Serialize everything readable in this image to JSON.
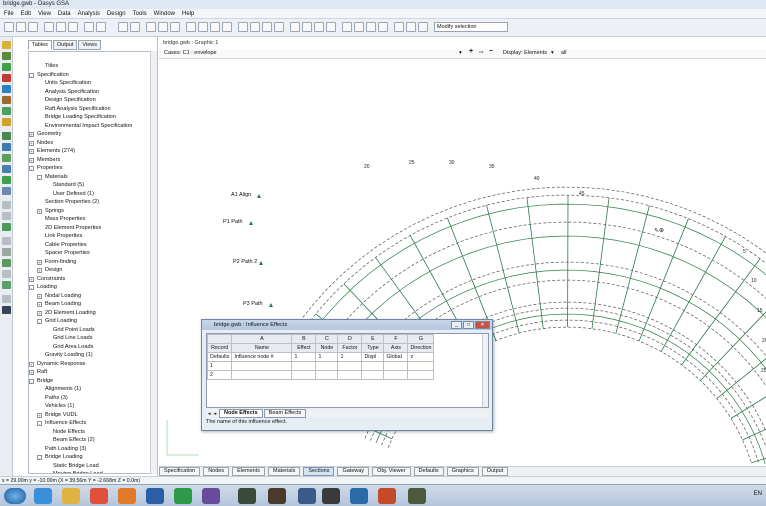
{
  "window": {
    "title": "bridge.gwb - Oasys GSA"
  },
  "menu": [
    "File",
    "Edit",
    "View",
    "Data",
    "Analysis",
    "Design",
    "Tools",
    "Window",
    "Help"
  ],
  "toolbar": {
    "mode_select": "Modify selection"
  },
  "left_panel": {
    "tabs": [
      "Tables",
      "Output",
      "Views"
    ],
    "tree": [
      {
        "label": "Titles",
        "level": 1,
        "exp": ""
      },
      {
        "label": "Specification",
        "level": 0,
        "exp": "-"
      },
      {
        "label": "Units Specification",
        "level": 1,
        "exp": ""
      },
      {
        "label": "Analysis Specification",
        "level": 1,
        "exp": ""
      },
      {
        "label": "Design Specification",
        "level": 1,
        "exp": ""
      },
      {
        "label": "Raft Analysis Specification",
        "level": 1,
        "exp": ""
      },
      {
        "label": "Bridge Loading Specification",
        "level": 1,
        "exp": ""
      },
      {
        "label": "Environmental Impact Specification",
        "level": 1,
        "exp": ""
      },
      {
        "label": "Geometry",
        "level": 0,
        "exp": "+"
      },
      {
        "label": "Nodes",
        "level": 0,
        "exp": "+"
      },
      {
        "label": "Elements (274)",
        "level": 0,
        "exp": "+"
      },
      {
        "label": "Members",
        "level": 0,
        "exp": "+"
      },
      {
        "label": "Properties",
        "level": 0,
        "exp": "-"
      },
      {
        "label": "Materials",
        "level": 1,
        "exp": "-"
      },
      {
        "label": "Standard (5)",
        "level": 2,
        "exp": ""
      },
      {
        "label": "User Defined (1)",
        "level": 2,
        "exp": ""
      },
      {
        "label": "Section Properties (2)",
        "level": 1,
        "exp": ""
      },
      {
        "label": "Springs",
        "level": 1,
        "exp": "+"
      },
      {
        "label": "Mass Properties",
        "level": 1,
        "exp": ""
      },
      {
        "label": "2D Element Properties",
        "level": 1,
        "exp": ""
      },
      {
        "label": "Link Properties",
        "level": 1,
        "exp": ""
      },
      {
        "label": "Cable Properties",
        "level": 1,
        "exp": ""
      },
      {
        "label": "Spacer Properties",
        "level": 1,
        "exp": ""
      },
      {
        "label": "Form-finding",
        "level": 1,
        "exp": "+"
      },
      {
        "label": "Design",
        "level": 1,
        "exp": "+"
      },
      {
        "label": "Constraints",
        "level": 0,
        "exp": "+"
      },
      {
        "label": "Loading",
        "level": 0,
        "exp": "-"
      },
      {
        "label": "Nodal Loading",
        "level": 1,
        "exp": "+"
      },
      {
        "label": "Beam Loading",
        "level": 1,
        "exp": "+"
      },
      {
        "label": "2D Element Loading",
        "level": 1,
        "exp": "+"
      },
      {
        "label": "Grid Loading",
        "level": 1,
        "exp": "-"
      },
      {
        "label": "Grid Point Loads",
        "level": 2,
        "exp": ""
      },
      {
        "label": "Grid Line Loads",
        "level": 2,
        "exp": ""
      },
      {
        "label": "Grid Area Loads",
        "level": 2,
        "exp": ""
      },
      {
        "label": "Gravity Loading (1)",
        "level": 1,
        "exp": ""
      },
      {
        "label": "Dynamic Response",
        "level": 0,
        "exp": "+"
      },
      {
        "label": "Raft",
        "level": 0,
        "exp": "+"
      },
      {
        "label": "Bridge",
        "level": 0,
        "exp": "-"
      },
      {
        "label": "Alignments (1)",
        "level": 1,
        "exp": ""
      },
      {
        "label": "Paths (3)",
        "level": 1,
        "exp": ""
      },
      {
        "label": "Vehicles (1)",
        "level": 1,
        "exp": ""
      },
      {
        "label": "Bridge VUDL",
        "level": 1,
        "exp": "+"
      },
      {
        "label": "Influence Effects",
        "level": 1,
        "exp": "-"
      },
      {
        "label": "Node Effects",
        "level": 2,
        "exp": ""
      },
      {
        "label": "Beam Effects (2)",
        "level": 2,
        "exp": ""
      },
      {
        "label": "Path Loading (3)",
        "level": 1,
        "exp": ""
      },
      {
        "label": "Bridge Loading",
        "level": 1,
        "exp": "-"
      },
      {
        "label": "Static Bridge Load",
        "level": 2,
        "exp": ""
      },
      {
        "label": "Moving Bridge Load",
        "level": 2,
        "exp": ""
      }
    ]
  },
  "graphic": {
    "tab": "bridge.gwb : Graphic 1",
    "cases": "Cases: C1 : envelope",
    "display": "Display: Elements",
    "all": "all",
    "path_labels": [
      "A1 Align",
      "P1 Path",
      "P2 Path 2",
      "P3 Path"
    ],
    "top_nums": [
      "20",
      "25",
      "30",
      "35",
      "40",
      "45"
    ],
    "side_nums": [
      "5",
      "10",
      "15",
      "20",
      "25"
    ]
  },
  "dialog": {
    "title": "bridge.gwb : Influence Effects",
    "col_letters": [
      "",
      "A",
      "B",
      "C",
      "D",
      "E",
      "F",
      "G"
    ],
    "headers": [
      "Record",
      "Name",
      "Effect",
      "Node",
      "Factor",
      "Type",
      "Axis",
      "Direction"
    ],
    "rows": [
      [
        "Defaults",
        "Influence node #",
        "1",
        "1",
        "1",
        "Displ",
        "Global",
        "z"
      ],
      [
        "1",
        "",
        "",
        "",
        "",
        "",
        "",
        ""
      ],
      [
        "2",
        "",
        "",
        "",
        "",
        "",
        "",
        ""
      ]
    ],
    "tabs": [
      "Node Effects",
      "Beam Effects"
    ],
    "status": "The name of this influence effect."
  },
  "bottom_tabs": [
    "Specification",
    "Nodes",
    "Elements",
    "Materials",
    "Sections",
    "Gateway",
    "Obj. Viewer",
    "Defaults",
    "Graphics",
    "Output"
  ],
  "statusbar": "x = 29.00m  y = -10.00m  (X = 39.56m  Y = -2.668m  Z = 0.0m)",
  "taskbar": {
    "lang": "EN"
  }
}
